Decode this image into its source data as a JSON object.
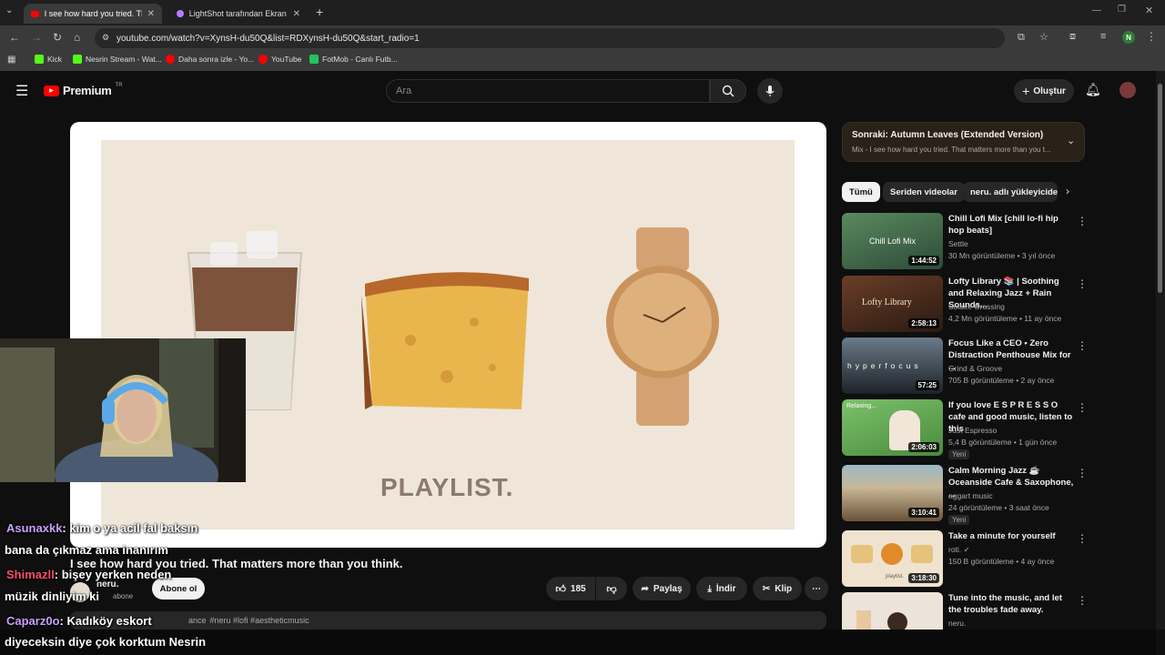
{
  "browser": {
    "tabs": [
      {
        "label": "I see how hard you tried. That m"
      },
      {
        "label": "LightShot tarafından Ekran Görü"
      }
    ],
    "url": "youtube.com/watch?v=XynsH-du50Q&list=RDXynsH-du50Q&start_radio=1",
    "bookmarks": [
      {
        "label": "Kick",
        "color": "#53fc18"
      },
      {
        "label": "Nesrin Stream - Wat...",
        "color": "#53fc18"
      },
      {
        "label": "Daha sonra izle - Yo...",
        "color": "#ff0000"
      },
      {
        "label": "YouTube",
        "color": "#ff0000"
      },
      {
        "label": "FotMob - Canlı Futb...",
        "color": "#22c55e"
      }
    ],
    "profile_initial": "N"
  },
  "header": {
    "logo": "Premium",
    "logo_region": "TR",
    "search_placeholder": "Ara",
    "create_label": "Oluştur"
  },
  "video": {
    "overlay_text": "PLAYLIST.",
    "title": "I see how hard you tried. That matters more than you think.",
    "channel": "neru.",
    "subscribers": "abone",
    "subscribe_label": "Abone ol",
    "likes": "185",
    "share_label": "Paylaş",
    "download_label": "İndir",
    "clip_label": "Klip",
    "description_tags": "#neru #lofi #aestheticmusic",
    "description_prefix": "ance"
  },
  "chat": [
    {
      "user": "Asunaxkk",
      "user_color": "#c9a0ff",
      "text": ": kim o ya acil fal baksın"
    },
    {
      "user": "",
      "user_color": "#fff",
      "text": "bana da çıkmaz ama inanırım"
    },
    {
      "user": "Shimazll",
      "user_color": "#ff4d6d",
      "text": ": bişey yerken neden"
    },
    {
      "user": "",
      "user_color": "#fff",
      "text": "müzik dinliyim ki"
    },
    {
      "user": "Caparz0o",
      "user_color": "#c9a0ff",
      "text": ": Kadıköy eskort"
    },
    {
      "user": "",
      "user_color": "#fff",
      "text": "diyeceksin diye çok korktum Nesrin"
    }
  ],
  "up_next": {
    "title": "Sonraki: Autumn Leaves (Extended Version)",
    "subtitle": "Mix - I see how hard you tried. That matters more than you t..."
  },
  "chips": [
    "Tümü",
    "Seriden videolar",
    "neru. adlı yükleyiciden"
  ],
  "recommendations": [
    {
      "title": "Chill Lofi Mix [chill lo-fi hip hop beats]",
      "channel": "Settle",
      "meta": "30 Mn görüntüleme • 3 yıl önce",
      "duration": "1:44:52",
      "thumb_text": "Chill Lofi Mix",
      "badge": "",
      "thumb_color": "#3d6b4a"
    },
    {
      "title": "Lofty Library 📚 | Soothing and Relaxing Jazz + Rain Sounds...",
      "channel": "Solace Crossing",
      "meta": "4,2 Mn görüntüleme • 11 ay önce",
      "duration": "2:58:13",
      "thumb_text": "Lofty Library",
      "badge": "",
      "thumb_color": "#4a2e20"
    },
    {
      "title": "Focus Like a CEO • Zero Distraction Penthouse Mix for ...",
      "channel": "Grind & Groove",
      "meta": "705 B görüntüleme • 2 ay önce",
      "duration": "57:25",
      "thumb_text": "hyperfocus",
      "badge": "",
      "thumb_color": "#2a3540"
    },
    {
      "title": "If you love E S P R E S S O cafe and good music, listen to this",
      "channel": "Just Espresso",
      "meta": "5,4 B görüntüleme • 1 gün önce",
      "duration": "2:06:03",
      "thumb_text": "Relaxing...",
      "badge": "Yeni",
      "thumb_color": "#6fae5e"
    },
    {
      "title": "Calm Morning Jazz ☕ Oceanside Cafe & Saxophone, ...",
      "channel": "aggart music",
      "meta": "24 görüntüleme • 3 saat önce",
      "duration": "3:10:41",
      "thumb_text": "",
      "badge": "Yeni",
      "thumb_color": "#8a7a60"
    },
    {
      "title": "Take a minute for yourself",
      "channel": "roti. ✓",
      "meta": "150 B görüntüleme • 4 ay önce",
      "duration": "3:18:30",
      "thumb_text": "playlist.",
      "badge": "",
      "thumb_color": "#efe3cf"
    },
    {
      "title": "Tune into the music, and let the troubles fade away.",
      "channel": "neru.",
      "meta": "",
      "duration": "",
      "thumb_text": "",
      "badge": "",
      "thumb_color": "#ece4d8"
    }
  ]
}
